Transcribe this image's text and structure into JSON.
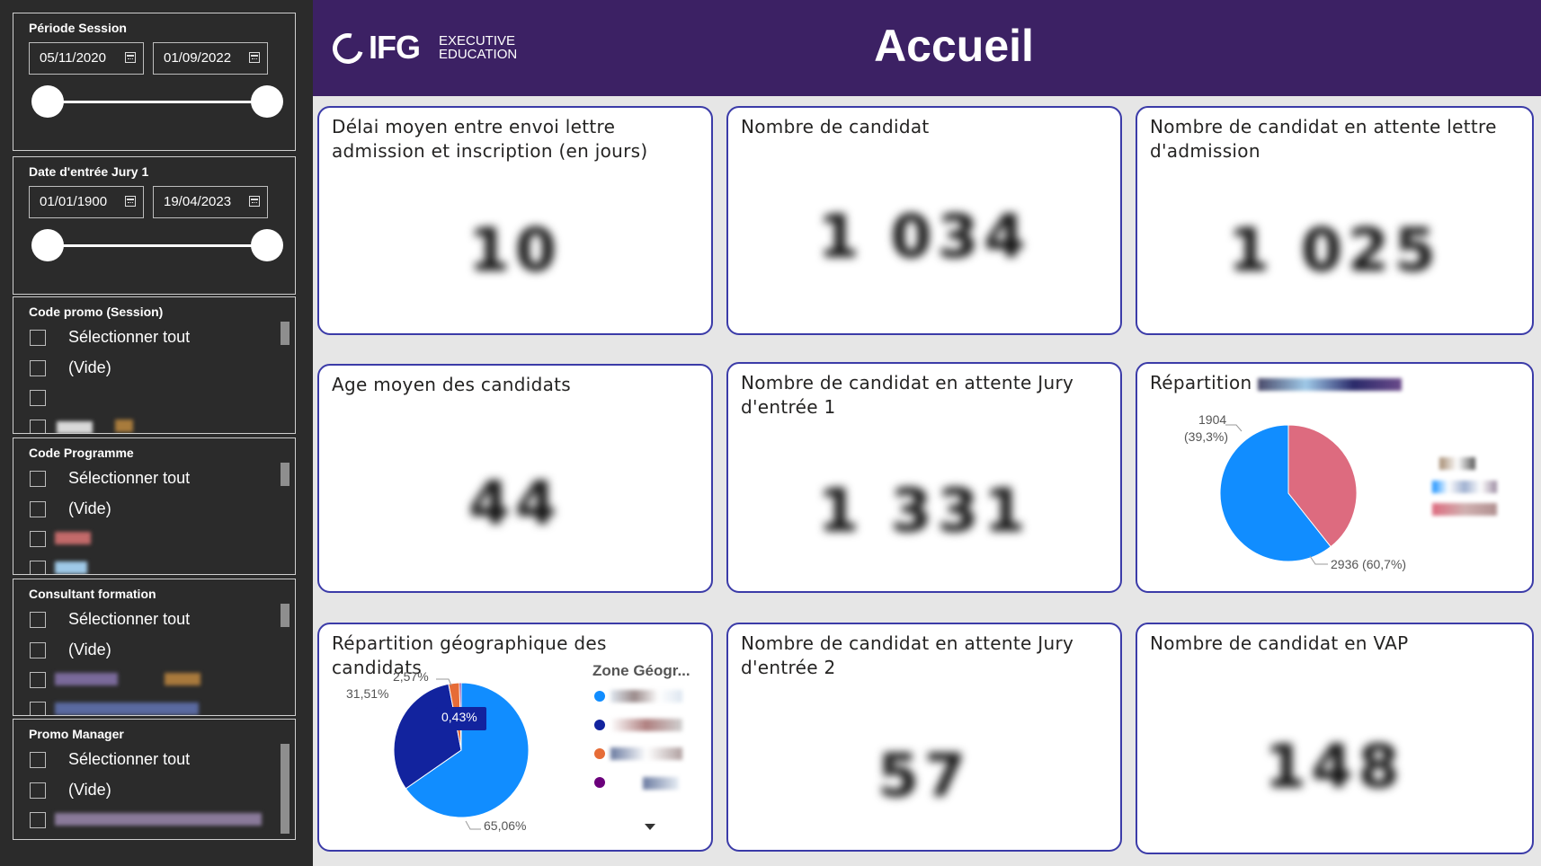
{
  "header": {
    "logo_main": "IFG",
    "logo_line1": "EXECUTIVE",
    "logo_line2": "EDUCATION",
    "title": "Accueil",
    "bg_color": "#3c2164"
  },
  "slicers": {
    "periode_session": {
      "title": "Période Session",
      "start": "05/11/2020",
      "end": "01/09/2022"
    },
    "date_entree_jury": {
      "title": "Date d'entrée Jury 1",
      "start": "01/01/1900",
      "end": "19/04/2023"
    },
    "lists": [
      {
        "title": "Code promo (Session)",
        "items": [
          "Sélectionner tout",
          "(Vide)"
        ]
      },
      {
        "title": "Code Programme",
        "items": [
          "Sélectionner tout",
          "(Vide)"
        ]
      },
      {
        "title": "Consultant formation",
        "items": [
          "Sélectionner tout",
          "(Vide)"
        ]
      },
      {
        "title": "Promo Manager",
        "items": [
          "Sélectionner tout",
          "(Vide)"
        ]
      }
    ]
  },
  "cards": {
    "delai": {
      "title": "Délai moyen entre envoi lettre admission et inscription (en jours)",
      "value": "10"
    },
    "nb_candidat": {
      "title": "Nombre de candidat",
      "value": "1 034"
    },
    "attente_lettre": {
      "title": "Nombre de candidat en attente lettre d'admission",
      "value": "1 025"
    },
    "age_moyen": {
      "title": "Age moyen des candidats",
      "value": "44"
    },
    "attente_jury1": {
      "title": "Nombre de candidat en attente Jury d'entrée 1",
      "value": "1 331"
    },
    "repartition": {
      "title": "Répartition",
      "label_a": "1904",
      "label_a_pct": "(39,3%)",
      "label_b": "2936 (60,7%)"
    },
    "geo": {
      "title": "Répartition géographique des candidats",
      "legend_title": "Zone Géogr...",
      "labels": {
        "a": "65,06%",
        "b": "31,51%",
        "c": "2,57%",
        "d": "0,43%"
      }
    },
    "attente_jury2": {
      "title": "Nombre de candidat en attente Jury d'entrée 2",
      "value": "57"
    },
    "vap": {
      "title": "Nombre de candidat en VAP",
      "value": "148"
    }
  },
  "chart_data": [
    {
      "type": "pie",
      "values": [
        1904,
        2936
      ],
      "percent_labels": [
        "39,3%",
        "60,7%"
      ],
      "colors": [
        "#dd6b7f",
        "#118dff"
      ]
    },
    {
      "type": "pie",
      "legend_title": "Zone Géogr...",
      "values": [
        65.06,
        31.51,
        2.57,
        0.43
      ],
      "percent_labels": [
        "65,06%",
        "31,51%",
        "2,57%",
        "0,43%"
      ],
      "colors": [
        "#118dff",
        "#12239e",
        "#e66c37",
        "#6b007b"
      ]
    }
  ]
}
